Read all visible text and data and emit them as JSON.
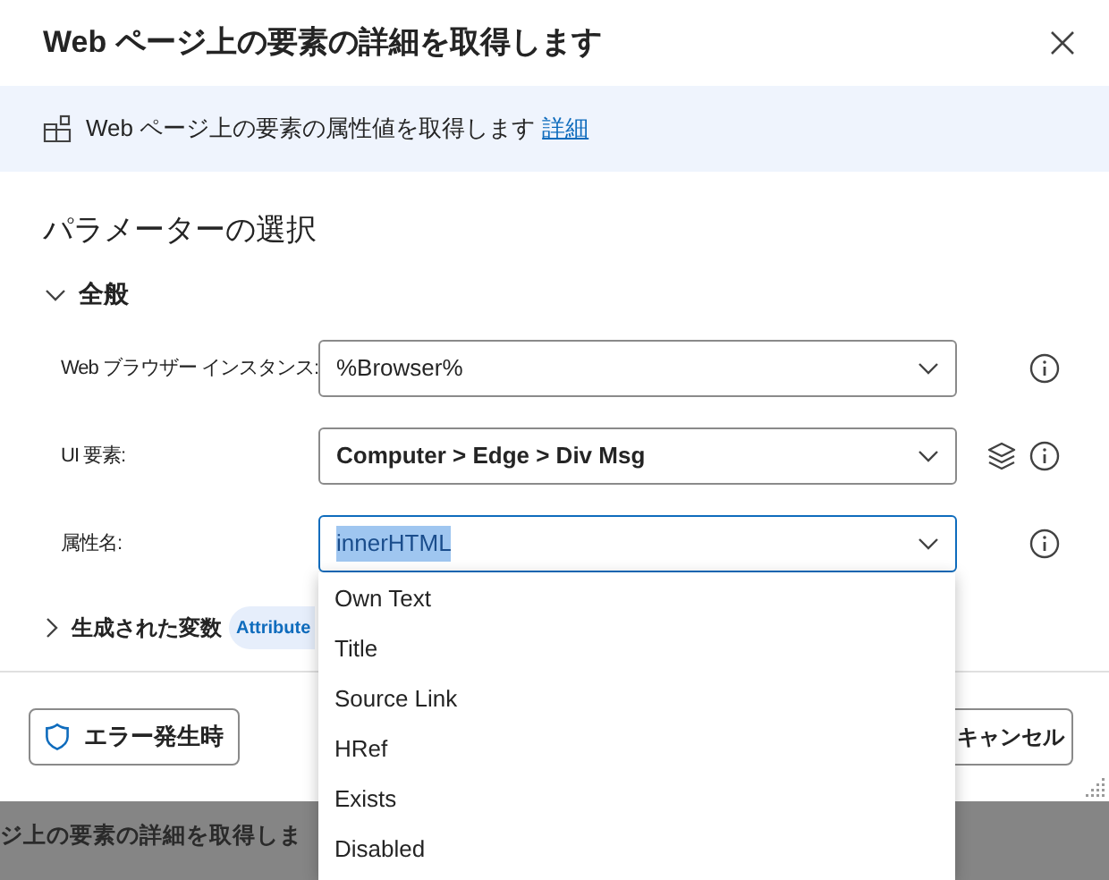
{
  "dialog": {
    "title": "Web ページ上の要素の詳細を取得します"
  },
  "info_bar": {
    "text": "Web ページ上の要素の属性値を取得します",
    "link": "詳細"
  },
  "section_title": "パラメーターの選択",
  "general": {
    "label": "全般",
    "expanded": true,
    "fields": [
      {
        "kind": "dropdown",
        "label": "Web ブラウザー インスタンス:",
        "value": "%Browser%",
        "focused": false,
        "text_selected": false
      },
      {
        "kind": "element_picker",
        "label": "UI 要素:",
        "value": "Computer > Edge > Div Msg",
        "focused": false,
        "text_selected": false
      },
      {
        "kind": "dropdown",
        "label": "属性名:",
        "value": "innerHTML",
        "focused": true,
        "text_selected": true
      }
    ]
  },
  "variables": {
    "label": "生成された変数",
    "expanded": false,
    "badge": "Attribute"
  },
  "footer": {
    "error_button": "エラー発生時",
    "cancel_button": "キャンセル"
  },
  "dropdown_options": [
    {
      "label": "Own Text",
      "selected": false
    },
    {
      "label": "Title",
      "selected": false
    },
    {
      "label": "Source Link",
      "selected": false
    },
    {
      "label": "HRef",
      "selected": false
    },
    {
      "label": "Exists",
      "selected": false
    },
    {
      "label": "Disabled",
      "selected": false
    }
  ],
  "background": {
    "text": "ジ上の要素の詳細を取得しま"
  }
}
